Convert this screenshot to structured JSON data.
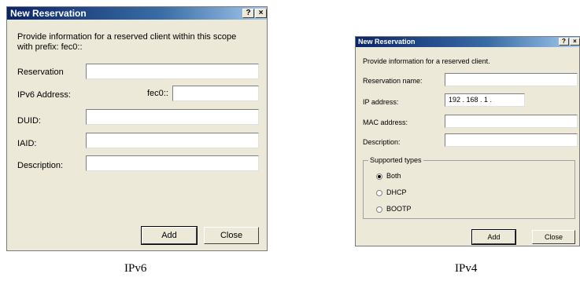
{
  "ipv6_dialog": {
    "title": "New Reservation",
    "help_btn": "?",
    "close_btn": "×",
    "intro_line1": "Provide information for a reserved client within this scope",
    "intro_line2": "with prefix:  fec0::",
    "labels": {
      "reservation": "Reservation",
      "ipv6_address": "IPv6 Address:",
      "prefix": "fec0::",
      "duid": "DUID:",
      "iaid": "IAID:",
      "description": "Description:"
    },
    "values": {
      "reservation": "",
      "ipv6_suffix": "",
      "duid": "",
      "iaid": "",
      "description": ""
    },
    "add_button": "Add",
    "close_button": "Close"
  },
  "ipv4_dialog": {
    "title": "New Reservation",
    "help_btn": "?",
    "close_btn": "×",
    "intro": "Provide information for a reserved client.",
    "labels": {
      "reservation_name": "Reservation name:",
      "ip_address": "IP address:",
      "mac_address": "MAC address:",
      "description": "Description:"
    },
    "values": {
      "reservation_name": "",
      "ip_address": "192 . 168 .  1  .",
      "mac_address": "",
      "description": ""
    },
    "supported_types": {
      "legend": "Supported types",
      "options": [
        "Both",
        "DHCP",
        "BOOTP"
      ],
      "selected": "Both"
    },
    "add_button": "Add",
    "close_button": "Close"
  },
  "captions": {
    "left": "IPv6",
    "right": "IPv4"
  }
}
